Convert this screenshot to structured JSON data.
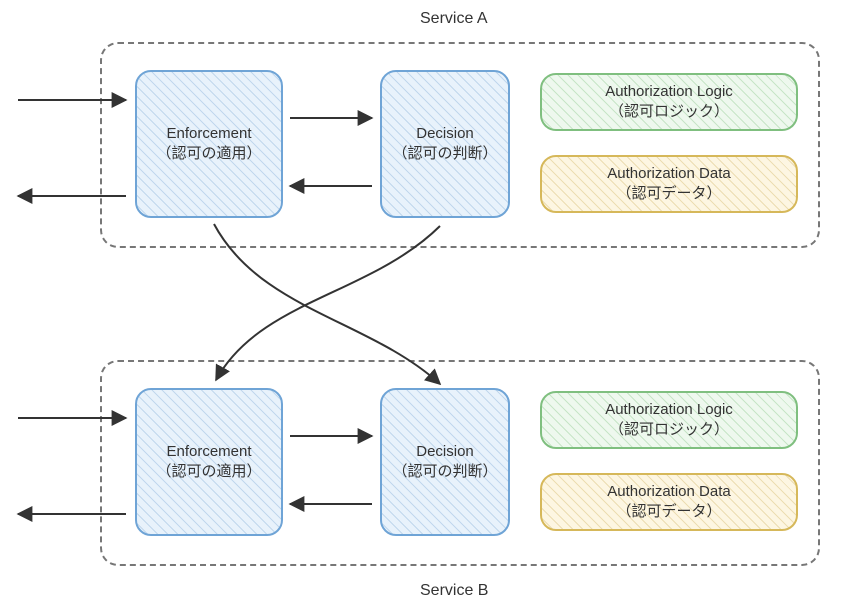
{
  "titles": {
    "service_a": "Service A",
    "service_b": "Service B"
  },
  "service_a": {
    "enforcement": {
      "en": "Enforcement",
      "jp": "（認可の適用）"
    },
    "decision": {
      "en": "Decision",
      "jp": "（認可の判断）"
    },
    "logic": {
      "en": "Authorization Logic",
      "jp": "（認可ロジック）"
    },
    "data": {
      "en": "Authorization Data",
      "jp": "（認可データ）"
    }
  },
  "service_b": {
    "enforcement": {
      "en": "Enforcement",
      "jp": "（認可の適用）"
    },
    "decision": {
      "en": "Decision",
      "jp": "（認可の判断）"
    },
    "logic": {
      "en": "Authorization Logic",
      "jp": "（認可ロジック）"
    },
    "data": {
      "en": "Authorization Data",
      "jp": "（認可データ）"
    }
  }
}
